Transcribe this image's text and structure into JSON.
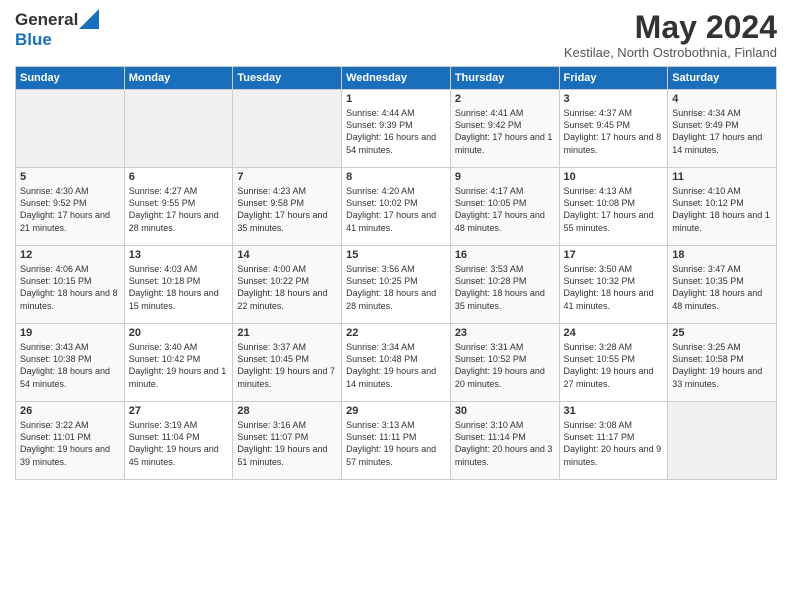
{
  "logo": {
    "general": "General",
    "blue": "Blue"
  },
  "title": "May 2024",
  "location": "Kestilae, North Ostrobothnia, Finland",
  "days_of_week": [
    "Sunday",
    "Monday",
    "Tuesday",
    "Wednesday",
    "Thursday",
    "Friday",
    "Saturday"
  ],
  "weeks": [
    [
      {
        "day": "",
        "info": ""
      },
      {
        "day": "",
        "info": ""
      },
      {
        "day": "",
        "info": ""
      },
      {
        "day": "1",
        "info": "Sunrise: 4:44 AM\nSunset: 9:39 PM\nDaylight: 16 hours and 54 minutes."
      },
      {
        "day": "2",
        "info": "Sunrise: 4:41 AM\nSunset: 9:42 PM\nDaylight: 17 hours and 1 minute."
      },
      {
        "day": "3",
        "info": "Sunrise: 4:37 AM\nSunset: 9:45 PM\nDaylight: 17 hours and 8 minutes."
      },
      {
        "day": "4",
        "info": "Sunrise: 4:34 AM\nSunset: 9:49 PM\nDaylight: 17 hours and 14 minutes."
      }
    ],
    [
      {
        "day": "5",
        "info": "Sunrise: 4:30 AM\nSunset: 9:52 PM\nDaylight: 17 hours and 21 minutes."
      },
      {
        "day": "6",
        "info": "Sunrise: 4:27 AM\nSunset: 9:55 PM\nDaylight: 17 hours and 28 minutes."
      },
      {
        "day": "7",
        "info": "Sunrise: 4:23 AM\nSunset: 9:58 PM\nDaylight: 17 hours and 35 minutes."
      },
      {
        "day": "8",
        "info": "Sunrise: 4:20 AM\nSunset: 10:02 PM\nDaylight: 17 hours and 41 minutes."
      },
      {
        "day": "9",
        "info": "Sunrise: 4:17 AM\nSunset: 10:05 PM\nDaylight: 17 hours and 48 minutes."
      },
      {
        "day": "10",
        "info": "Sunrise: 4:13 AM\nSunset: 10:08 PM\nDaylight: 17 hours and 55 minutes."
      },
      {
        "day": "11",
        "info": "Sunrise: 4:10 AM\nSunset: 10:12 PM\nDaylight: 18 hours and 1 minute."
      }
    ],
    [
      {
        "day": "12",
        "info": "Sunrise: 4:06 AM\nSunset: 10:15 PM\nDaylight: 18 hours and 8 minutes."
      },
      {
        "day": "13",
        "info": "Sunrise: 4:03 AM\nSunset: 10:18 PM\nDaylight: 18 hours and 15 minutes."
      },
      {
        "day": "14",
        "info": "Sunrise: 4:00 AM\nSunset: 10:22 PM\nDaylight: 18 hours and 22 minutes."
      },
      {
        "day": "15",
        "info": "Sunrise: 3:56 AM\nSunset: 10:25 PM\nDaylight: 18 hours and 28 minutes."
      },
      {
        "day": "16",
        "info": "Sunrise: 3:53 AM\nSunset: 10:28 PM\nDaylight: 18 hours and 35 minutes."
      },
      {
        "day": "17",
        "info": "Sunrise: 3:50 AM\nSunset: 10:32 PM\nDaylight: 18 hours and 41 minutes."
      },
      {
        "day": "18",
        "info": "Sunrise: 3:47 AM\nSunset: 10:35 PM\nDaylight: 18 hours and 48 minutes."
      }
    ],
    [
      {
        "day": "19",
        "info": "Sunrise: 3:43 AM\nSunset: 10:38 PM\nDaylight: 18 hours and 54 minutes."
      },
      {
        "day": "20",
        "info": "Sunrise: 3:40 AM\nSunset: 10:42 PM\nDaylight: 19 hours and 1 minute."
      },
      {
        "day": "21",
        "info": "Sunrise: 3:37 AM\nSunset: 10:45 PM\nDaylight: 19 hours and 7 minutes."
      },
      {
        "day": "22",
        "info": "Sunrise: 3:34 AM\nSunset: 10:48 PM\nDaylight: 19 hours and 14 minutes."
      },
      {
        "day": "23",
        "info": "Sunrise: 3:31 AM\nSunset: 10:52 PM\nDaylight: 19 hours and 20 minutes."
      },
      {
        "day": "24",
        "info": "Sunrise: 3:28 AM\nSunset: 10:55 PM\nDaylight: 19 hours and 27 minutes."
      },
      {
        "day": "25",
        "info": "Sunrise: 3:25 AM\nSunset: 10:58 PM\nDaylight: 19 hours and 33 minutes."
      }
    ],
    [
      {
        "day": "26",
        "info": "Sunrise: 3:22 AM\nSunset: 11:01 PM\nDaylight: 19 hours and 39 minutes."
      },
      {
        "day": "27",
        "info": "Sunrise: 3:19 AM\nSunset: 11:04 PM\nDaylight: 19 hours and 45 minutes."
      },
      {
        "day": "28",
        "info": "Sunrise: 3:16 AM\nSunset: 11:07 PM\nDaylight: 19 hours and 51 minutes."
      },
      {
        "day": "29",
        "info": "Sunrise: 3:13 AM\nSunset: 11:11 PM\nDaylight: 19 hours and 57 minutes."
      },
      {
        "day": "30",
        "info": "Sunrise: 3:10 AM\nSunset: 11:14 PM\nDaylight: 20 hours and 3 minutes."
      },
      {
        "day": "31",
        "info": "Sunrise: 3:08 AM\nSunset: 11:17 PM\nDaylight: 20 hours and 9 minutes."
      },
      {
        "day": "",
        "info": ""
      }
    ]
  ]
}
